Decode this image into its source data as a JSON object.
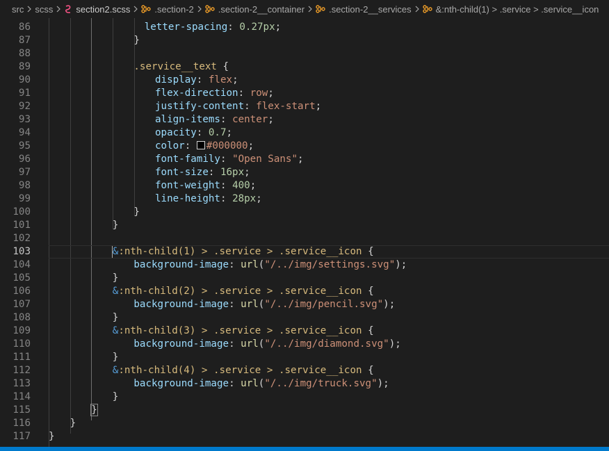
{
  "breadcrumb": [
    {
      "label": "src",
      "icon": null
    },
    {
      "label": "scss",
      "icon": null
    },
    {
      "label": "section2.scss",
      "icon": "sass-file-icon"
    },
    {
      "label": ".section-2",
      "icon": "selector-icon"
    },
    {
      "label": ".section-2__container",
      "icon": "selector-icon"
    },
    {
      "label": ".section-2__services",
      "icon": "selector-icon"
    },
    {
      "label": "&:nth-child(1) > .service > .service__icon",
      "icon": "selector-icon"
    }
  ],
  "editor": {
    "current_line": 103,
    "lines": [
      {
        "num": "86",
        "tokens": [
          [
            "p",
            "letter-spacing"
          ],
          [
            "c",
            ": "
          ],
          [
            "n",
            "0.27px"
          ],
          [
            "c",
            ";"
          ]
        ],
        "indent": 9
      },
      {
        "num": "87",
        "tokens": [
          [
            "c",
            "}"
          ]
        ],
        "indent": 8
      },
      {
        "num": "88",
        "tokens": [],
        "indent": 0
      },
      {
        "num": "89",
        "tokens": [
          [
            "s",
            ".service__text"
          ],
          [
            "c",
            " {"
          ]
        ],
        "indent": 8
      },
      {
        "num": "90",
        "tokens": [
          [
            "p",
            "display"
          ],
          [
            "c",
            ": "
          ],
          [
            "v",
            "flex"
          ],
          [
            "c",
            ";"
          ]
        ],
        "indent": 10
      },
      {
        "num": "91",
        "tokens": [
          [
            "p",
            "flex-direction"
          ],
          [
            "c",
            ": "
          ],
          [
            "v",
            "row"
          ],
          [
            "c",
            ";"
          ]
        ],
        "indent": 10
      },
      {
        "num": "92",
        "tokens": [
          [
            "p",
            "justify-content"
          ],
          [
            "c",
            ": "
          ],
          [
            "v",
            "flex-start"
          ],
          [
            "c",
            ";"
          ]
        ],
        "indent": 10
      },
      {
        "num": "93",
        "tokens": [
          [
            "p",
            "align-items"
          ],
          [
            "c",
            ": "
          ],
          [
            "v",
            "center"
          ],
          [
            "c",
            ";"
          ]
        ],
        "indent": 10
      },
      {
        "num": "94",
        "tokens": [
          [
            "p",
            "opacity"
          ],
          [
            "c",
            ": "
          ],
          [
            "n",
            "0.7"
          ],
          [
            "c",
            ";"
          ]
        ],
        "indent": 10
      },
      {
        "num": "95",
        "tokens": [
          [
            "p",
            "color"
          ],
          [
            "c",
            ": "
          ],
          [
            "swatch",
            ""
          ],
          [
            "v",
            "#000000"
          ],
          [
            "c",
            ";"
          ]
        ],
        "indent": 10
      },
      {
        "num": "96",
        "tokens": [
          [
            "p",
            "font-family"
          ],
          [
            "c",
            ": "
          ],
          [
            "v",
            "\"Open Sans\""
          ],
          [
            "c",
            ";"
          ]
        ],
        "indent": 10
      },
      {
        "num": "97",
        "tokens": [
          [
            "p",
            "font-size"
          ],
          [
            "c",
            ": "
          ],
          [
            "n",
            "16px"
          ],
          [
            "c",
            ";"
          ]
        ],
        "indent": 10
      },
      {
        "num": "98",
        "tokens": [
          [
            "p",
            "font-weight"
          ],
          [
            "c",
            ": "
          ],
          [
            "n",
            "400"
          ],
          [
            "c",
            ";"
          ]
        ],
        "indent": 10
      },
      {
        "num": "99",
        "tokens": [
          [
            "p",
            "line-height"
          ],
          [
            "c",
            ": "
          ],
          [
            "n",
            "28px"
          ],
          [
            "c",
            ";"
          ]
        ],
        "indent": 10
      },
      {
        "num": "100",
        "tokens": [
          [
            "c",
            "}"
          ]
        ],
        "indent": 8
      },
      {
        "num": "101",
        "tokens": [
          [
            "c",
            "}"
          ]
        ],
        "indent": 6
      },
      {
        "num": "102",
        "tokens": [],
        "indent": 0
      },
      {
        "num": "103",
        "tokens": [
          [
            "cursor",
            ""
          ],
          [
            "amp",
            "&"
          ],
          [
            "s",
            ":nth-child(1) > .service > .service__icon"
          ],
          [
            "c",
            " {"
          ]
        ],
        "indent": 6
      },
      {
        "num": "104",
        "tokens": [
          [
            "p",
            "background-image"
          ],
          [
            "c",
            ": "
          ],
          [
            "f",
            "url"
          ],
          [
            "c",
            "("
          ],
          [
            "v",
            "\"/../img/settings.svg\""
          ],
          [
            "c",
            ");"
          ]
        ],
        "indent": 8
      },
      {
        "num": "105",
        "tokens": [
          [
            "c",
            "}"
          ]
        ],
        "indent": 6
      },
      {
        "num": "106",
        "tokens": [
          [
            "amp",
            "&"
          ],
          [
            "s",
            ":nth-child(2) > .service > .service__icon"
          ],
          [
            "c",
            " {"
          ]
        ],
        "indent": 6
      },
      {
        "num": "107",
        "tokens": [
          [
            "p",
            "background-image"
          ],
          [
            "c",
            ": "
          ],
          [
            "f",
            "url"
          ],
          [
            "c",
            "("
          ],
          [
            "v",
            "\"/../img/pencil.svg\""
          ],
          [
            "c",
            ");"
          ]
        ],
        "indent": 8
      },
      {
        "num": "108",
        "tokens": [
          [
            "c",
            "}"
          ]
        ],
        "indent": 6
      },
      {
        "num": "109",
        "tokens": [
          [
            "amp",
            "&"
          ],
          [
            "s",
            ":nth-child(3) > .service > .service__icon"
          ],
          [
            "c",
            " {"
          ]
        ],
        "indent": 6
      },
      {
        "num": "110",
        "tokens": [
          [
            "p",
            "background-image"
          ],
          [
            "c",
            ": "
          ],
          [
            "f",
            "url"
          ],
          [
            "c",
            "("
          ],
          [
            "v",
            "\"/../img/diamond.svg\""
          ],
          [
            "c",
            ");"
          ]
        ],
        "indent": 8
      },
      {
        "num": "111",
        "tokens": [
          [
            "c",
            "}"
          ]
        ],
        "indent": 6
      },
      {
        "num": "112",
        "tokens": [
          [
            "amp",
            "&"
          ],
          [
            "s",
            ":nth-child(4) > .service > .service__icon"
          ],
          [
            "c",
            " {"
          ]
        ],
        "indent": 6
      },
      {
        "num": "113",
        "tokens": [
          [
            "p",
            "background-image"
          ],
          [
            "c",
            ": "
          ],
          [
            "f",
            "url"
          ],
          [
            "c",
            "("
          ],
          [
            "v",
            "\"/../img/truck.svg\""
          ],
          [
            "c",
            ");"
          ]
        ],
        "indent": 8
      },
      {
        "num": "114",
        "tokens": [
          [
            "c",
            "}"
          ]
        ],
        "indent": 6
      },
      {
        "num": "115",
        "tokens": [
          [
            "bm",
            "}"
          ]
        ],
        "indent": 4
      },
      {
        "num": "116",
        "tokens": [
          [
            "c",
            "}"
          ]
        ],
        "indent": 2
      },
      {
        "num": "117",
        "tokens": [
          [
            "c",
            "}"
          ]
        ],
        "indent": 0
      }
    ]
  },
  "colors": {
    "accent": "#007acc",
    "background": "#1e1e1e"
  }
}
